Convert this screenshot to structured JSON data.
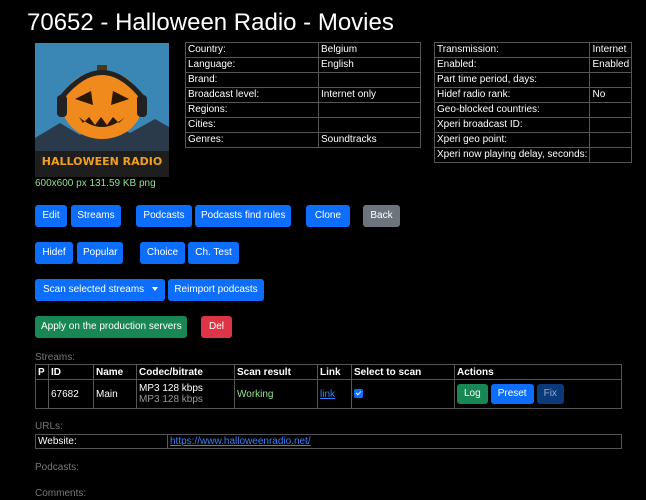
{
  "title": "70652 - Halloween Radio - Movies",
  "logo": {
    "caption": "600x600 px 131.59 KB png",
    "text": "HALLOWEEN RADIO"
  },
  "info_left": [
    {
      "label": "Country:",
      "value": "Belgium"
    },
    {
      "label": "Language:",
      "value": "English"
    },
    {
      "label": "Brand:",
      "value": ""
    },
    {
      "label": "Broadcast level:",
      "value": "Internet only"
    },
    {
      "label": "Regions:",
      "value": ""
    },
    {
      "label": "Cities:",
      "value": ""
    },
    {
      "label": "Genres:",
      "value": "Soundtracks"
    }
  ],
  "info_right": [
    {
      "label": "Transmission:",
      "value": "Internet"
    },
    {
      "label": "Enabled:",
      "value": "Enabled"
    },
    {
      "label": "Part time period, days:",
      "value": ""
    },
    {
      "label": "Hidef radio rank:",
      "value": "No"
    },
    {
      "label": "Geo-blocked countries:",
      "value": ""
    },
    {
      "label": "Xperi broadcast ID:",
      "value": ""
    },
    {
      "label": "Xperi geo point:",
      "value": ""
    },
    {
      "label": "Xperi now playing delay, seconds:",
      "value": ""
    }
  ],
  "buttons": {
    "edit": "Edit",
    "streams": "Streams",
    "podcasts": "Podcasts",
    "podcasts_find_rules": "Podcasts find rules",
    "clone": "Clone",
    "back": "Back",
    "hidef": "Hidef",
    "popular": "Popular",
    "choice": "Choice",
    "ch_test": "Ch. Test",
    "scan_selected": "Scan selected streams",
    "reimport_podcasts": "Reimport podcasts",
    "apply_production": "Apply on the production servers",
    "del": "Del"
  },
  "streams": {
    "label": "Streams:",
    "headers": [
      "P",
      "ID",
      "Name",
      "Codec/bitrate",
      "Scan result",
      "Link",
      "Select to scan",
      "Actions"
    ],
    "rows": [
      {
        "p": "",
        "id": "67682",
        "name": "Main",
        "codec": "MP3 128 kbps",
        "codec2": "MP3 128 kbps",
        "scan": "Working",
        "link": "link",
        "selected": true,
        "actions": {
          "log": "Log",
          "preset": "Preset",
          "fix": "Fix"
        }
      }
    ]
  },
  "urls": {
    "label": "URLs:",
    "website_label": "Website:",
    "website_url": "https://www.halloweenradio.net/"
  },
  "podcasts_label": "Podcasts:",
  "comments_label": "Comments:",
  "colors": {
    "primary": "#0d6efd",
    "success": "#198754",
    "danger": "#dc3545",
    "secondary": "#6c757d"
  }
}
